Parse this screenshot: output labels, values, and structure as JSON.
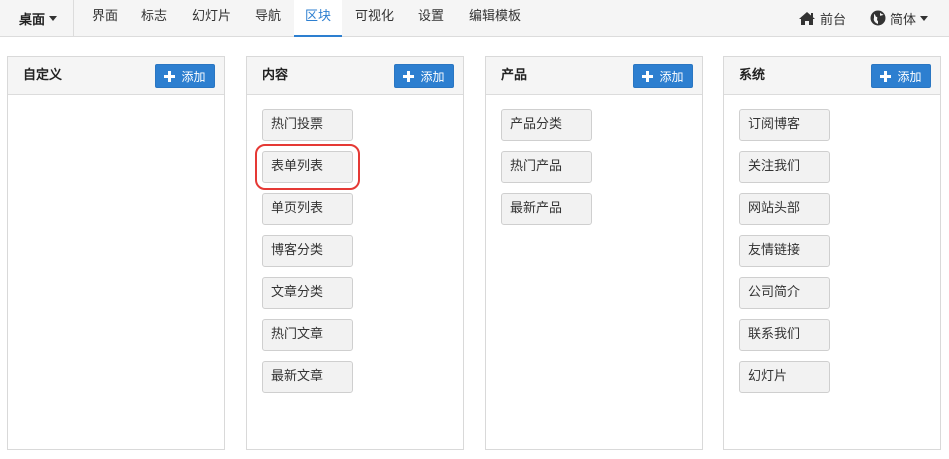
{
  "nav": {
    "brand": "桌面",
    "items": [
      "界面",
      "标志",
      "幻灯片",
      "导航",
      "区块",
      "可视化",
      "设置",
      "编辑模板"
    ],
    "active": "区块",
    "frontend": "前台",
    "language": "简体"
  },
  "panels": [
    {
      "title": "自定义",
      "add_label": "添加",
      "items": []
    },
    {
      "title": "内容",
      "add_label": "添加",
      "items": [
        "热门投票",
        "表单列表",
        "单页列表",
        "博客分类",
        "文章分类",
        "热门文章",
        "最新文章"
      ]
    },
    {
      "title": "产品",
      "add_label": "添加",
      "items": [
        "产品分类",
        "热门产品",
        "最新产品"
      ]
    },
    {
      "title": "系统",
      "add_label": "添加",
      "items": [
        "订阅博客",
        "关注我们",
        "网站头部",
        "友情链接",
        "公司简介",
        "联系我们",
        "幻灯片"
      ]
    }
  ],
  "colors": {
    "accent": "#2d7fd0",
    "highlight": "#e53935"
  }
}
